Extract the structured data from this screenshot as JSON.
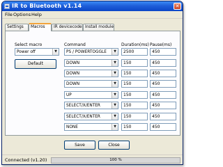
{
  "window": {
    "title": "IR to Bluetooth v1.14"
  },
  "menu": {
    "items": [
      "File",
      "Options",
      "Help"
    ]
  },
  "tabs": [
    "Settings",
    "Macros",
    "IR devicecode",
    "Install module"
  ],
  "macros": {
    "select_macro_label": "Select macro",
    "select_macro_value": "Power off",
    "default_button": "Default",
    "headers": {
      "command": "Command",
      "duration": "Duration(ms)",
      "pause": "Pause(ms)"
    },
    "rows": [
      {
        "command": "PS / POWERTOGGLE",
        "duration": "2500",
        "pause": "450"
      },
      {
        "command": "DOWN",
        "duration": "150",
        "pause": "450"
      },
      {
        "command": "DOWN",
        "duration": "150",
        "pause": "450"
      },
      {
        "command": "DOWN",
        "duration": "150",
        "pause": "450"
      },
      {
        "command": "UP",
        "duration": "150",
        "pause": "450"
      },
      {
        "command": "SELECT/X/ENTER",
        "duration": "150",
        "pause": "450"
      },
      {
        "command": "SELECT/X/ENTER",
        "duration": "150",
        "pause": "450"
      },
      {
        "command": "NONE",
        "duration": "150",
        "pause": "450"
      }
    ]
  },
  "buttons": {
    "save": "Save",
    "close": "Close"
  },
  "status": {
    "text": "Connected (v1.20)",
    "progress_text": "100 %",
    "progress_value": 1.0
  },
  "icons": {
    "close": "close-icon",
    "dropdown": "chevron-down-icon",
    "app": "app-icon"
  },
  "colors": {
    "titlebar": "#1f5fd9",
    "active_tab_accent": "#f2a33a"
  }
}
